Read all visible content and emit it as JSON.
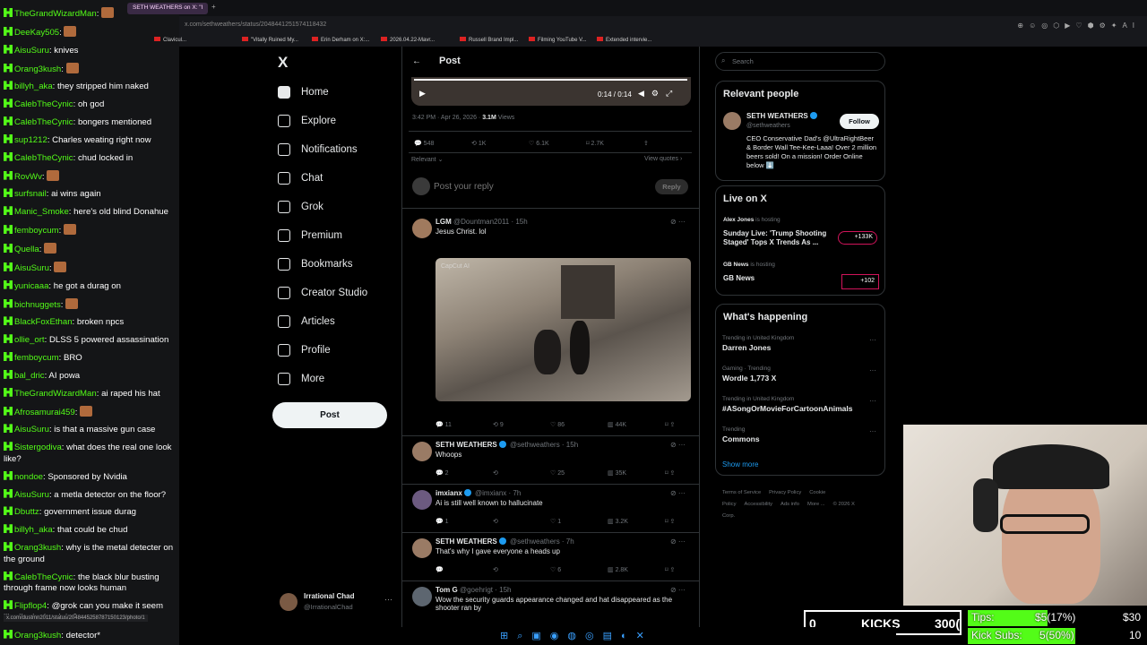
{
  "browser": {
    "tabs": [
      "SETH WEATHERS on X: \"I"
    ],
    "url": "x.com/sethweathers/status/2048441251574118432",
    "status_url": "x.com/dustmn2011/status/2048445258787150123/photo/1",
    "bookmarks": [
      "Clavicul...",
      "\"Vitally Ruined My...",
      "Erin Derham on X:...",
      "2026.04.22-Mavr...",
      "Russell Brand Impl...",
      "Filming YouTube V...",
      "Extended intervie..."
    ]
  },
  "chat": {
    "messages": [
      {
        "user": "TheGrandWizardMan",
        "text": ""
      },
      {
        "user": "DeeKay505",
        "text": ""
      },
      {
        "user": "AisuSuru",
        "text": "knives"
      },
      {
        "user": "Orang3kush",
        "text": ""
      },
      {
        "user": "billyh_aka",
        "text": "they stripped him naked"
      },
      {
        "user": "CalebTheCynic",
        "text": "oh god"
      },
      {
        "user": "CalebTheCynic",
        "text": "bongers mentioned"
      },
      {
        "user": "sup1212",
        "text": "Charles weating right now"
      },
      {
        "user": "CalebTheCynic",
        "text": "chud locked in"
      },
      {
        "user": "RovWv",
        "text": ""
      },
      {
        "user": "surfsnail",
        "text": "ai wins again"
      },
      {
        "user": "Manic_Smoke",
        "text": "here's old blind Donahue"
      },
      {
        "user": "femboycum",
        "text": ""
      },
      {
        "user": "Quella",
        "text": ""
      },
      {
        "user": "AisuSuru",
        "text": ""
      },
      {
        "user": "yunicaaa",
        "text": "he got a durag on"
      },
      {
        "user": "bichnuggets",
        "text": ""
      },
      {
        "user": "BlackFoxEthan",
        "text": "broken npcs"
      },
      {
        "user": "ollie_ort",
        "text": "DLSS 5 powered assassination"
      },
      {
        "user": "femboycum",
        "text": "BRO"
      },
      {
        "user": "bal_dric",
        "text": "AI powa"
      },
      {
        "user": "TheGrandWizardMan",
        "text": "ai raped his hat"
      },
      {
        "user": "Afrosamurai459",
        "text": ""
      },
      {
        "user": "AisuSuru",
        "text": "is that a massive gun case"
      },
      {
        "user": "Sistergodiva",
        "text": "what does the real one look like?"
      },
      {
        "user": "nondoe",
        "text": "Sponsored by Nvidia"
      },
      {
        "user": "AisuSuru",
        "text": "a metla detector on the floor?"
      },
      {
        "user": "Dbuttz",
        "text": "government issue durag"
      },
      {
        "user": "billyh_aka",
        "text": "that could be chud"
      },
      {
        "user": "Orang3kush",
        "text": "why is the metal detecter on the ground"
      },
      {
        "user": "CalebTheCynic",
        "text": "the black blur busting through frame now looks human"
      },
      {
        "user": "Flipflop4",
        "text": "@grok can you make it seem like I'm in the right?"
      },
      {
        "user": "Orang3kush",
        "text": "detector*"
      }
    ]
  },
  "x": {
    "logo": "X",
    "nav": [
      "Home",
      "Explore",
      "Notifications",
      "Chat",
      "Grok",
      "Premium",
      "Bookmarks",
      "Creator Studio",
      "Articles",
      "Profile",
      "More"
    ],
    "nav_icons": [
      "home-icon",
      "explore-icon",
      "notifications-icon",
      "chat-icon",
      "grok-icon",
      "premium-icon",
      "bookmarks-icon",
      "creator-studio-icon",
      "articles-icon",
      "profile-icon",
      "more-icon"
    ],
    "post_button": "Post",
    "account": {
      "name": "Irrational Chad",
      "handle": "@IrrationalChad"
    },
    "header_title": "Post",
    "video_time": "0:14 / 0:14",
    "post_meta": {
      "time": "3:42 PM · Apr 26, 2026 ·",
      "views": "3.1M",
      "views_label": "Views"
    },
    "post_actions": {
      "replies": "548",
      "reposts": "1K",
      "likes": "6.1K",
      "bookmarks": "2.7K"
    },
    "relevant": "Relevant",
    "view_quotes": "View quotes",
    "reply_placeholder": "Post your reply",
    "reply_button": "Reply",
    "replies": [
      {
        "name": "LGM",
        "handle": "@Dountman2011 · 15h",
        "text": "Jesus Christ.  lol",
        "stats": [
          "11",
          "9",
          "86",
          "44K"
        ]
      },
      {
        "name": "SETH WEATHERS",
        "handle": "@sethweathers · 15h",
        "text": "Whoops",
        "stats": [
          "2",
          "",
          "25",
          "35K"
        ]
      },
      {
        "name": "imxianx",
        "handle": "@imxianx · 7h",
        "text": "Ai is still well known to hallucinate",
        "stats": [
          "1",
          "",
          "1",
          "3.2K"
        ]
      },
      {
        "name": "SETH WEATHERS",
        "handle": "@sethweathers · 7h",
        "text": "That's why I gave everyone a heads up",
        "stats": [
          "",
          "",
          "6",
          "2.8K"
        ]
      },
      {
        "name": "Tom G",
        "handle": "@goehrigt · 15h",
        "text": "Wow the security guards appearance changed and hat disappeared as the shooter ran by",
        "stats": []
      }
    ],
    "media_watermark": "CapCut AI",
    "search_placeholder": "Search",
    "relevant_people": {
      "title": "Relevant people",
      "name": "SETH WEATHERS",
      "handle": "@sethweathers",
      "follow": "Follow",
      "bio": "CEO Conservative Dad's @UltraRightBeer & Border Wall Tee-Kee-Laaa! Over 2 million beers sold! On a mission! Order Online below ⬇️"
    },
    "live": {
      "title": "Live on X",
      "items": [
        {
          "host": "Alex Jones",
          "status": "is hosting",
          "title": "Sunday Live: 'Trump Shooting Staged' Tops X Trends As ...",
          "count": "+133K"
        },
        {
          "host": "GB News",
          "status": "is hosting",
          "title": "GB News",
          "count": "+102"
        }
      ]
    },
    "happening": {
      "title": "What's happening",
      "trends": [
        {
          "context": "Trending in United Kingdom",
          "name": "Darren Jones"
        },
        {
          "context": "Gaming · Trending",
          "name": "Wordle 1,773 X"
        },
        {
          "context": "Trending in United Kingdom",
          "name": "#ASongOrMovieForCartoonAnimals"
        },
        {
          "context": "Trending",
          "name": "Commons"
        }
      ],
      "show_more": "Show more"
    },
    "footer": [
      "Terms of Service",
      "Privacy Policy",
      "Cookie Policy",
      "Accessibility",
      "Ads info",
      "More ...",
      "© 2026 X Corp."
    ]
  },
  "overlay": {
    "kicks_left": "0",
    "kicks_label": "KICKS",
    "kicks_right": "300(",
    "tips_label": "Tips:",
    "tips_value": "$5(17%)",
    "tips_goal": "$30",
    "subs_label": "Kick Subs:",
    "subs_value": "5(50%)",
    "subs_goal": "10",
    "tips_fraction": 0.17,
    "subs_fraction": 0.5
  },
  "colors": {
    "kick_green": "#53fc18",
    "x_blue": "#1d9bf0",
    "bg": "#000000"
  }
}
